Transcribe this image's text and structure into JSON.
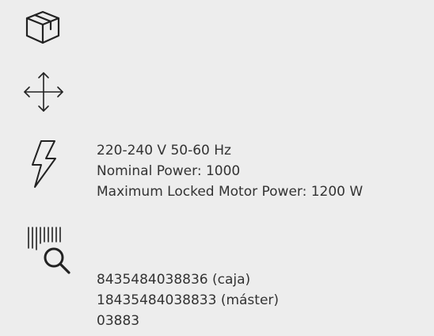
{
  "icons": {
    "package": "box-icon",
    "dimensions": "move-arrows-icon",
    "power": "lightning-icon",
    "barcode": "barcode-search-icon"
  },
  "power": {
    "voltage": "220-240 V 50-60 Hz",
    "nominal": "Nominal Power: 1000",
    "max_locked": "Maximum Locked Motor Power: 1200 W"
  },
  "codes": {
    "box": "8435484038836 (caja)",
    "master": "18435484038833 (máster)",
    "reference": "03883"
  },
  "colors": {
    "background": "#ededed",
    "text": "#333333",
    "icon": "#222222"
  }
}
